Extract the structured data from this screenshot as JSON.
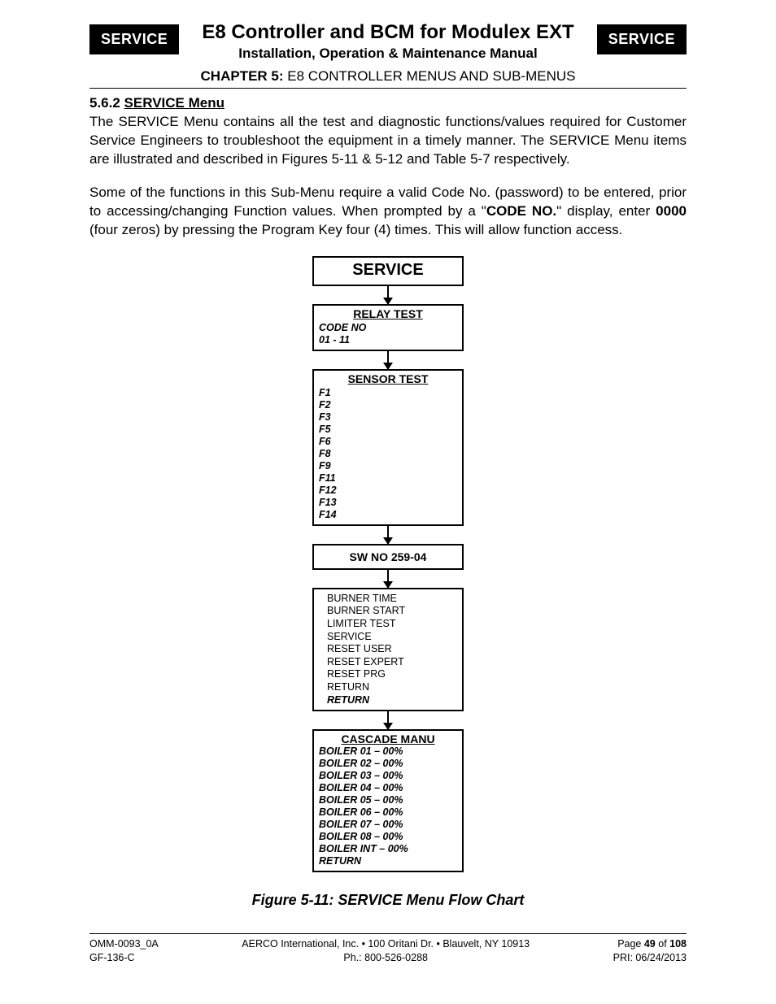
{
  "header": {
    "badge": "SERVICE",
    "title": "E8 Controller and BCM for Modulex EXT",
    "subtitle": "Installation, Operation & Maintenance Manual",
    "chapter_label": "CHAPTER 5:",
    "chapter_text": " E8 CONTROLLER MENUS AND SUB-MENUS"
  },
  "section": {
    "number": "5.6.2 ",
    "label": "SERVICE Menu"
  },
  "para1": "The SERVICE Menu contains all the test and diagnostic functions/values required for Customer Service Engineers to troubleshoot the equipment in a timely manner. The SERVICE Menu items are illustrated and described in Figures 5-11 & 5-12 and Table 5-7 respectively.",
  "para2_a": "Some of the functions in this Sub-Menu require a valid Code No. (password) to be entered, prior to accessing/changing Function values. When prompted by a \"",
  "para2_b": "CODE NO.",
  "para2_c": "\" display, enter ",
  "para2_d": "0000",
  "para2_e": " (four zeros) by pressing the Program Key four (4) times. This will allow function access.",
  "chart_data": {
    "type": "flowchart",
    "nodes": [
      {
        "id": "service",
        "title": "SERVICE"
      },
      {
        "id": "relay",
        "heading": "RELAY TEST",
        "items": [
          "CODE NO",
          "01 - 11"
        ]
      },
      {
        "id": "sensor",
        "heading": "SENSOR TEST",
        "items": [
          "F1",
          "F2",
          "F3",
          "F5",
          "F6",
          "F8",
          "F9",
          "F11",
          "F12",
          "F13",
          "F14"
        ]
      },
      {
        "id": "sw",
        "heading": "SW NO 259-04"
      },
      {
        "id": "misc",
        "items": [
          "BURNER TIME",
          "BURNER START",
          "LIMITER TEST",
          "SERVICE",
          "RESET USER",
          "RESET EXPERT",
          "RESET PRG",
          "RETURN"
        ],
        "trailingItalic": "RETURN"
      },
      {
        "id": "cascade",
        "heading": "CASCADE MANU",
        "items": [
          "BOILER 01 – 00%",
          "BOILER 02 – 00%",
          "BOILER 03 – 00%",
          "BOILER 04 – 00%",
          "BOILER 05 – 00%",
          "BOILER 06 – 00%",
          "BOILER 07 – 00%",
          "BOILER 08 – 00%",
          "BOILER INT – 00%",
          "RETURN"
        ]
      }
    ],
    "edges": [
      [
        "service",
        "relay"
      ],
      [
        "relay",
        "sensor"
      ],
      [
        "sensor",
        "sw"
      ],
      [
        "sw",
        "misc"
      ],
      [
        "misc",
        "cascade"
      ]
    ]
  },
  "figure_caption": "Figure 5-11: SERVICE Menu Flow Chart",
  "footer": {
    "left1": "OMM-0093_0A",
    "left2": "GF-136-C",
    "center1": "AERCO International, Inc. • 100 Oritani Dr. • Blauvelt, NY 10913",
    "center2": "Ph.: 800-526-0288",
    "right1a": "Page ",
    "right1b": "49",
    "right1c": " of ",
    "right1d": "108",
    "right2": "PRI:  06/24/2013"
  }
}
